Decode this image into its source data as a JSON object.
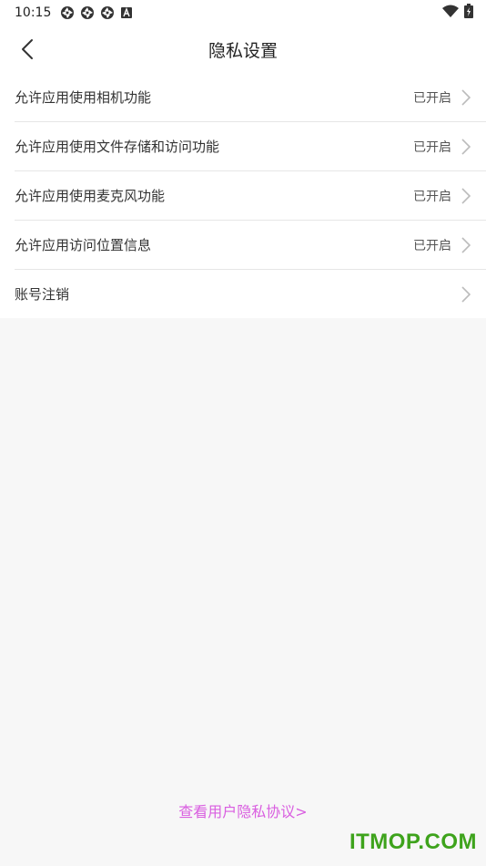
{
  "status_bar": {
    "time": "10:15",
    "icons": [
      "app-notification-icon",
      "app-notification-icon",
      "app-notification-icon",
      "keyboard-a-icon",
      "wifi-icon",
      "battery-icon"
    ]
  },
  "header": {
    "back_icon": "chevron-left-icon",
    "title": "隐私设置"
  },
  "settings": {
    "items": [
      {
        "label": "允许应用使用相机功能",
        "status": "已开启"
      },
      {
        "label": "允许应用使用文件存储和访问功能",
        "status": "已开启"
      },
      {
        "label": "允许应用使用麦克风功能",
        "status": "已开启"
      },
      {
        "label": "允许应用访问位置信息",
        "status": "已开启"
      },
      {
        "label": "账号注销",
        "status": ""
      }
    ]
  },
  "footer": {
    "policy_link": "查看用户隐私协议>",
    "watermark": "ITMOP.COM"
  },
  "colors": {
    "link": "#d95ee0",
    "watermark": "#3ea31c"
  }
}
